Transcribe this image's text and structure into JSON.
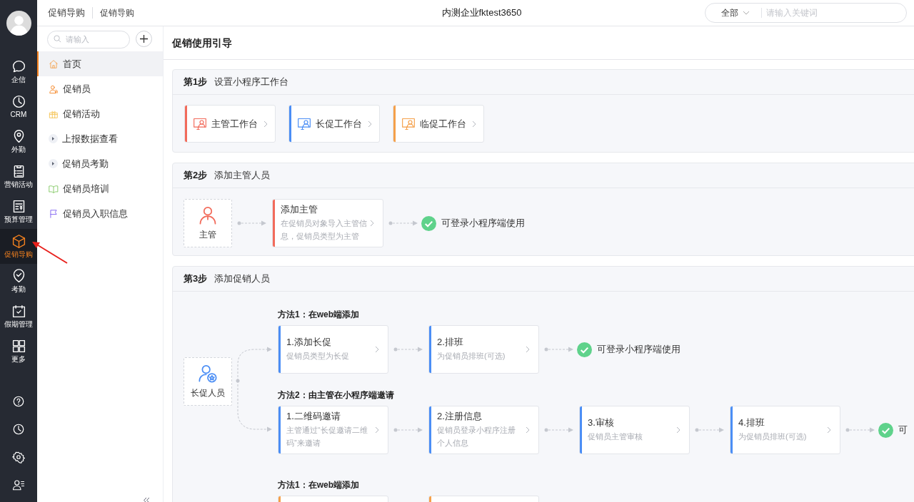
{
  "rail": {
    "items": [
      {
        "label": "企信",
        "kind": "chat",
        "selected": false
      },
      {
        "label": "CRM",
        "kind": "clock",
        "selected": false
      },
      {
        "label": "外勤",
        "kind": "pin",
        "selected": false
      },
      {
        "label": "营销活动",
        "kind": "clipboard",
        "selected": false
      },
      {
        "label": "预算管理",
        "kind": "budget",
        "selected": false
      },
      {
        "label": "促销导购",
        "kind": "cube",
        "selected": true
      },
      {
        "label": "考勤",
        "kind": "pin-check",
        "selected": false
      },
      {
        "label": "假期管理",
        "kind": "calendar",
        "selected": false
      },
      {
        "label": "更多",
        "kind": "grid",
        "selected": false
      }
    ],
    "bottom_icons": [
      {
        "kind": "help"
      },
      {
        "kind": "clock"
      },
      {
        "kind": "gear"
      },
      {
        "kind": "user-list"
      }
    ]
  },
  "header": {
    "breadcrumb": [
      "促销导购",
      "促销导购"
    ],
    "title": "内测企业fktest3650",
    "search": {
      "scope": "全部",
      "placeholder": "请输入关键词"
    }
  },
  "sidebar": {
    "search": {
      "placeholder": "请输入"
    },
    "items": [
      {
        "label": "首页",
        "kind": "home",
        "selected": true
      },
      {
        "label": "促销员",
        "kind": "person",
        "selected": false
      },
      {
        "label": "促销活动",
        "kind": "gift",
        "selected": false
      },
      {
        "label": "上报数据查看",
        "kind": "expander",
        "expanded": false,
        "selected": false
      },
      {
        "label": "促销员考勤",
        "kind": "expander",
        "expanded": false,
        "selected": false
      },
      {
        "label": "促销员培训",
        "kind": "book",
        "selected": false
      },
      {
        "label": "促销员入职信息",
        "kind": "flag",
        "selected": false
      }
    ]
  },
  "page_title": "促销使用引导",
  "steps": [
    {
      "label": "第1步",
      "title": "设置小程序工作台",
      "kind": "tiles",
      "tiles": [
        {
          "label": "主管工作台",
          "color": "#f26b5b"
        },
        {
          "label": "长促工作台",
          "color": "#4b8ef5"
        },
        {
          "label": "临促工作台",
          "color": "#f5a04a"
        }
      ]
    },
    {
      "label": "第2步",
      "title": "添加主管人员",
      "kind": "flow",
      "groups": [
        {
          "node": {
            "label": "主管",
            "kind": "manager"
          },
          "methods": [
            {
              "cards": [
                {
                  "title": "添加主管",
                  "desc": "在促销员对象导入主管信息，促销员类型为主管",
                  "color": "#f26b5b"
                }
              ],
              "result": "可登录小程序端使用"
            }
          ]
        }
      ]
    },
    {
      "label": "第3步",
      "title": "添加促销人员",
      "kind": "flow",
      "groups": [
        {
          "node": {
            "label": "长促人员",
            "kind": "staff"
          },
          "methods": [
            {
              "heading": "方法1：在web端添加",
              "cards": [
                {
                  "title": "1.添加长促",
                  "desc": "促销员类型为长促",
                  "color": "#4b8ef5"
                },
                {
                  "title": "2.排班",
                  "desc": "为促销员排班(可选)",
                  "color": "#4b8ef5"
                }
              ],
              "result": "可登录小程序端使用"
            },
            {
              "heading": "方法2：由主管在小程序端邀请",
              "cards": [
                {
                  "title": "1.二维码邀请",
                  "desc": "主管通过“长促邀请二维码”来邀请",
                  "color": "#4b8ef5"
                },
                {
                  "title": "2.注册信息",
                  "desc": "促销员登录小程序注册个人信息",
                  "color": "#4b8ef5"
                },
                {
                  "title": "3.审核",
                  "desc": "促销员主管审核",
                  "color": "#4b8ef5"
                },
                {
                  "title": "4.排班",
                  "desc": "为促销员排班(可选)",
                  "color": "#4b8ef5"
                }
              ],
              "result": "可"
            }
          ]
        },
        {
          "methods": [
            {
              "heading": "方法1：在web端添加",
              "cards": [
                {
                  "color": "#f5a04a"
                },
                {
                  "color": "#f5a04a"
                }
              ]
            }
          ]
        }
      ]
    }
  ]
}
